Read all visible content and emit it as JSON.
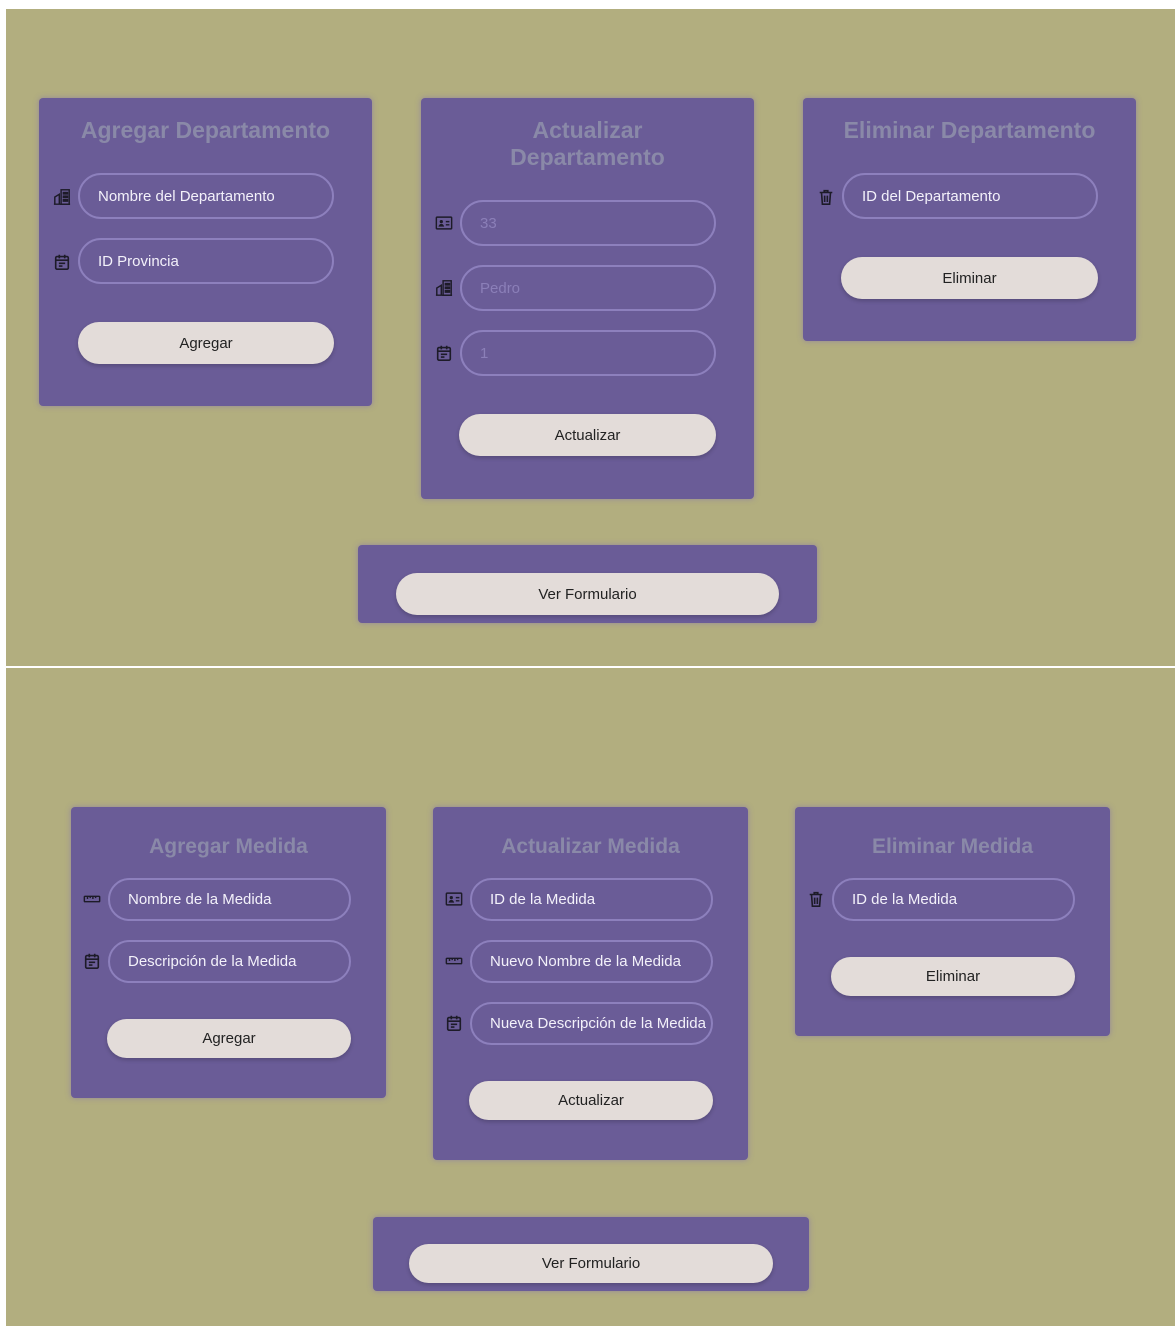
{
  "departamento": {
    "agregar": {
      "title": "Agregar Departamento",
      "nombre_placeholder": "Nombre del Departamento",
      "provincia_placeholder": "ID Provincia",
      "button": "Agregar",
      "icons": [
        "building-icon",
        "calendar-icon"
      ]
    },
    "actualizar": {
      "title_line1": "Actualizar",
      "title_line2": "Departamento",
      "id_value": "33",
      "nombre_value": "Pedro",
      "provincia_value": "1",
      "button": "Actualizar",
      "icons": [
        "id-card-icon",
        "building-icon",
        "calendar-icon"
      ]
    },
    "eliminar": {
      "title": "Eliminar Departamento",
      "id_placeholder": "ID del Departamento",
      "button": "Eliminar",
      "icons": [
        "trash-icon"
      ]
    },
    "ver_formulario": "Ver Formulario"
  },
  "medida": {
    "agregar": {
      "title": "Agregar Medida",
      "nombre_placeholder": "Nombre de la Medida",
      "descripcion_placeholder": "Descripción de la Medida",
      "button": "Agregar",
      "icons": [
        "ruler-icon",
        "calendar-icon"
      ]
    },
    "actualizar": {
      "title": "Actualizar Medida",
      "id_placeholder": "ID de la Medida",
      "nombre_placeholder": "Nuevo Nombre de la Medida",
      "descripcion_placeholder": "Nueva Descripción de la Medida",
      "button": "Actualizar",
      "icons": [
        "id-card-icon",
        "ruler-icon",
        "calendar-icon"
      ]
    },
    "eliminar": {
      "title": "Eliminar Medida",
      "id_placeholder": "ID de la Medida",
      "button": "Eliminar",
      "icons": [
        "trash-icon"
      ]
    },
    "ver_formulario": "Ver Formulario"
  },
  "colors": {
    "background": "#b2ae7f",
    "card": "#6a5c97",
    "title": "#8a89a8",
    "input_border": "#8d80bd",
    "button": "#e3dcd9"
  }
}
